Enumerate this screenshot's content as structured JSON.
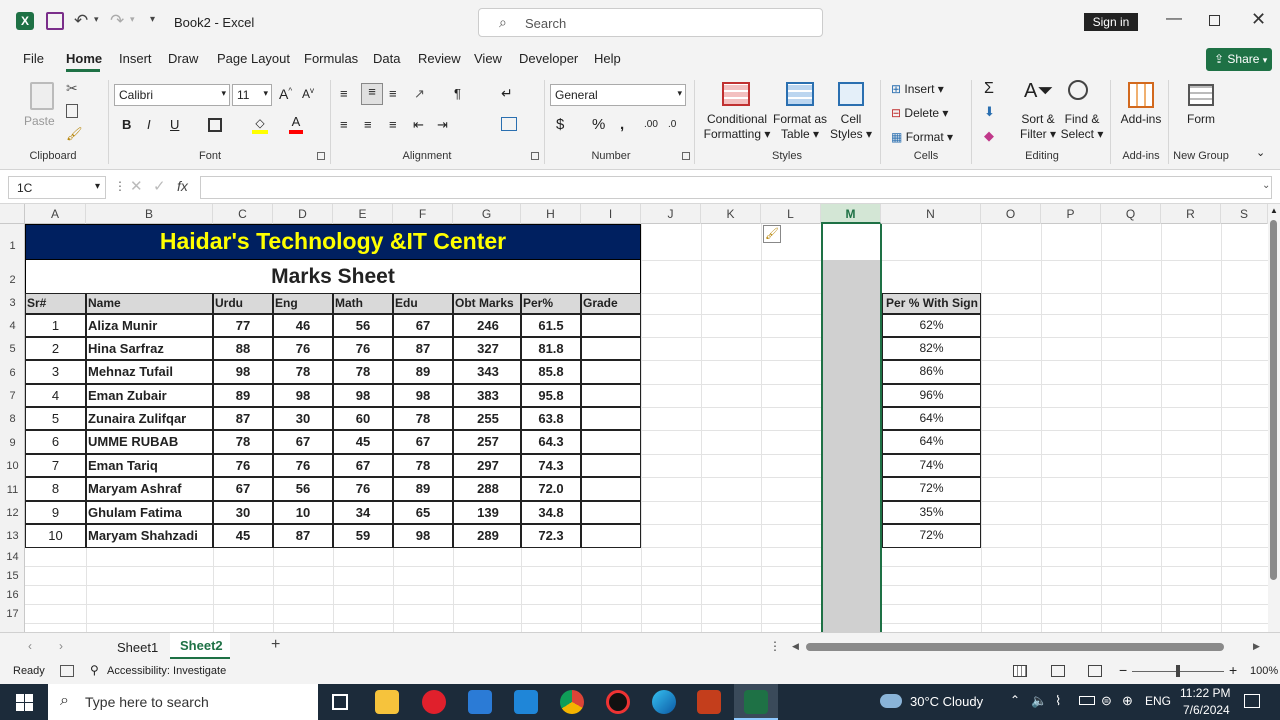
{
  "titlebar": {
    "doc_title": "Book2 - Excel",
    "search_placeholder": "Search",
    "signin_label": "Sign in"
  },
  "tabs": [
    "File",
    "Home",
    "Insert",
    "Draw",
    "Page Layout",
    "Formulas",
    "Data",
    "Review",
    "View",
    "Developer",
    "Help"
  ],
  "share_label": "Share",
  "ribbon": {
    "paste": "Paste",
    "clipboard": "Clipboard",
    "font_name": "Calibri",
    "font_size": "11",
    "font": "Font",
    "alignment": "Alignment",
    "number_format": "General",
    "number": "Number",
    "cond_fmt_1": "Conditional",
    "cond_fmt_2": "Formatting",
    "fmt_table_1": "Format as",
    "fmt_table_2": "Table",
    "cell_styles_1": "Cell",
    "cell_styles_2": "Styles",
    "styles": "Styles",
    "insert": "Insert",
    "delete": "Delete",
    "format": "Format",
    "cells": "Cells",
    "sort_1": "Sort &",
    "sort_2": "Filter",
    "find_1": "Find &",
    "find_2": "Select",
    "editing": "Editing",
    "addins_btn": "Add-ins",
    "addins_grp": "Add-ins",
    "form_btn": "Form",
    "newgroup": "New Group"
  },
  "formula_bar": {
    "name_box": "1C",
    "fx": "fx",
    "formula": ""
  },
  "columns": [
    "A",
    "B",
    "C",
    "D",
    "E",
    "F",
    "G",
    "H",
    "I",
    "J",
    "K",
    "L",
    "M",
    "N",
    "O",
    "P",
    "Q",
    "R",
    "S"
  ],
  "rows": [
    "1",
    "2",
    "3",
    "4",
    "5",
    "6",
    "7",
    "8",
    "9",
    "10",
    "11",
    "12",
    "13",
    "14",
    "15",
    "16",
    "17"
  ],
  "sheet": {
    "title": "Haidar's Technology &IT Center",
    "subtitle": "Marks Sheet",
    "headers": [
      "Sr#",
      "Name",
      "Urdu",
      "Eng",
      "Math",
      "Edu",
      "Obt Marks",
      "Per%",
      "Grade"
    ],
    "records": [
      [
        "1",
        "Aliza Munir",
        "77",
        "46",
        "56",
        "67",
        "246",
        "61.5",
        ""
      ],
      [
        "2",
        "Hina Sarfraz",
        "88",
        "76",
        "76",
        "87",
        "327",
        "81.8",
        ""
      ],
      [
        "3",
        "Mehnaz Tufail",
        "98",
        "78",
        "78",
        "89",
        "343",
        "85.8",
        ""
      ],
      [
        "4",
        "Eman Zubair",
        "89",
        "98",
        "98",
        "98",
        "383",
        "95.8",
        ""
      ],
      [
        "5",
        "Zunaira Zulifqar",
        "87",
        "30",
        "60",
        "78",
        "255",
        "63.8",
        ""
      ],
      [
        "6",
        "UMME RUBAB",
        "78",
        "67",
        "45",
        "67",
        "257",
        "64.3",
        ""
      ],
      [
        "7",
        "Eman Tariq",
        "76",
        "76",
        "67",
        "78",
        "297",
        "74.3",
        ""
      ],
      [
        "8",
        "Maryam Ashraf",
        "67",
        "56",
        "76",
        "89",
        "288",
        "72.0",
        ""
      ],
      [
        "9",
        "Ghulam Fatima",
        "30",
        "10",
        "34",
        "65",
        "139",
        "34.8",
        ""
      ],
      [
        "10",
        "Maryam Shahzadi",
        "45",
        "87",
        "59",
        "98",
        "289",
        "72.3",
        ""
      ]
    ],
    "sign_header": "Per % With Sign",
    "sign_values": [
      "62%",
      "82%",
      "86%",
      "96%",
      "64%",
      "64%",
      "74%",
      "72%",
      "35%",
      "72%"
    ]
  },
  "sheet_tabs": [
    "Sheet1",
    "Sheet2"
  ],
  "status": {
    "ready": "Ready",
    "accessibility": "Accessibility: Investigate",
    "zoom": "100%"
  },
  "taskbar": {
    "search_placeholder": "Type here to search",
    "weather": "30°C  Cloudy",
    "lang": "ENG",
    "time": "11:22 PM",
    "date": "7/6/2024"
  },
  "colors": {
    "title_bg": "#002060",
    "title_fg": "#ffff00",
    "excel_green": "#1e7145",
    "selected_col": "#d0d0d0"
  }
}
